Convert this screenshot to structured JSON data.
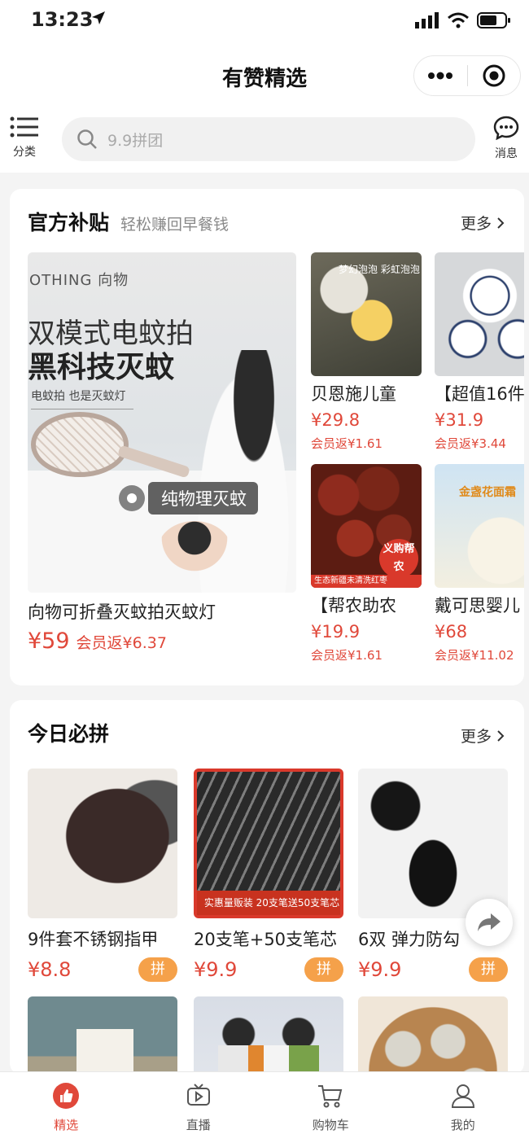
{
  "status": {
    "time": "13:23"
  },
  "header": {
    "title": "有赞精选"
  },
  "topbar": {
    "category_label": "分类",
    "search_placeholder": "9.9拼团",
    "message_label": "消息"
  },
  "section1": {
    "title": "官方补贴",
    "subtitle": "轻松赚回早餐钱",
    "more": "更多",
    "featured": {
      "brand": "OTHING 向物",
      "headline1": "双模式电蚊拍",
      "headline2": "黑科技灭蚊",
      "headline3": "电蚊拍 也是灭蚊灯",
      "overlay_tag": "纯物理灭蚊",
      "name": "向物可折叠灭蚊拍灭蚊灯",
      "price": "¥59",
      "cashback": "会员返¥6.37"
    },
    "items": [
      {
        "name": "贝恩施儿童",
        "price": "¥29.8",
        "cashback": "会员返¥1.61",
        "img_text": "梦幻泡泡 彩虹泡泡"
      },
      {
        "name": "【超值16件",
        "price": "¥31.9",
        "cashback": "会员返¥3.44"
      },
      {
        "name": "【帮农助农",
        "price": "¥19.9",
        "cashback": "会员返¥1.61",
        "badge": "义购帮农",
        "strip": "生态新疆未清洗红枣"
      },
      {
        "name": "戴可思婴儿",
        "price": "¥68",
        "cashback": "会员返¥11.02",
        "img_text": "金盏花面霜"
      }
    ]
  },
  "section2": {
    "title": "今日必拼",
    "more": "更多",
    "pin_label": "拼",
    "items": [
      {
        "name": "9件套不锈钢指甲",
        "price": "¥8.8"
      },
      {
        "name": "20支笔+50支笔芯",
        "price": "¥9.9",
        "img_text": "实惠量贩装 20支笔送50支笔芯"
      },
      {
        "name": "6双 弹力防勾",
        "price": "¥9.9"
      }
    ]
  },
  "tabbar": {
    "tabs": [
      {
        "label": "精选",
        "icon": "thumbs-up-icon",
        "active": true
      },
      {
        "label": "直播",
        "icon": "tv-play-icon",
        "active": false
      },
      {
        "label": "购物车",
        "icon": "cart-icon",
        "active": false
      },
      {
        "label": "我的",
        "icon": "person-icon",
        "active": false
      }
    ]
  },
  "colors": {
    "accent": "#e0483a",
    "pin": "#f5a14a"
  }
}
